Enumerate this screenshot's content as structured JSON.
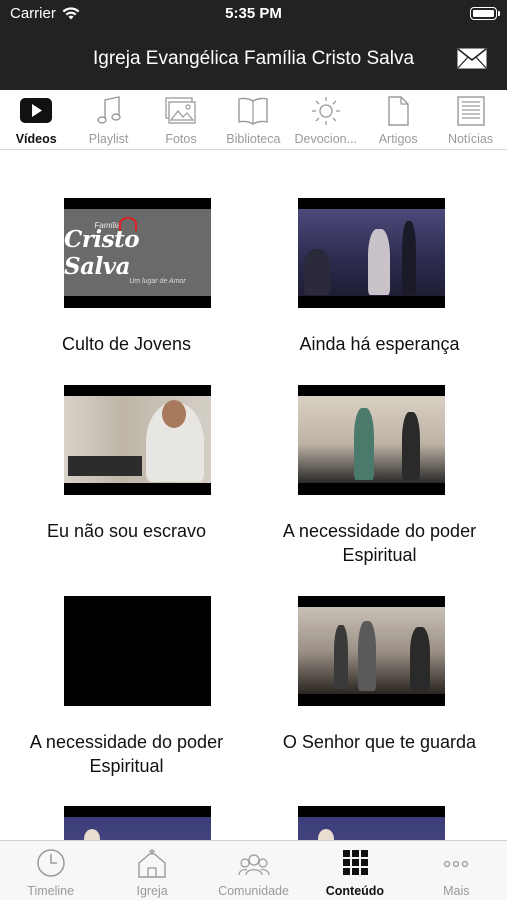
{
  "status_bar": {
    "carrier": "Carrier",
    "time": "5:35 PM"
  },
  "header": {
    "title": "Igreja Evangélica Família Cristo Salva",
    "mail_icon": "envelope-icon"
  },
  "top_tabs": [
    {
      "label": "Vídeos",
      "icon": "play-icon",
      "active": true
    },
    {
      "label": "Playlist",
      "icon": "music-note-icon",
      "active": false
    },
    {
      "label": "Fotos",
      "icon": "photos-icon",
      "active": false
    },
    {
      "label": "Biblioteca",
      "icon": "book-icon",
      "active": false
    },
    {
      "label": "Devocion...",
      "icon": "sun-icon",
      "active": false
    },
    {
      "label": "Artigos",
      "icon": "document-icon",
      "active": false
    },
    {
      "label": "Notícias",
      "icon": "news-icon",
      "active": false
    }
  ],
  "videos": [
    {
      "title": "Culto de Jovens",
      "thumb": "logo",
      "logo": {
        "top": "Família",
        "main": "Cristo Salva",
        "sub": "Um lugar de Amor"
      }
    },
    {
      "title": "Ainda há esperança",
      "thumb": "stage"
    },
    {
      "title": "Eu não sou escravo",
      "thumb": "office"
    },
    {
      "title": "A necessidade do poder Espiritual",
      "thumb": "stage2"
    },
    {
      "title": "A necessidade do poder Espiritual",
      "thumb": "dark"
    },
    {
      "title": "O Senhor que te guarda",
      "thumb": "stage3"
    },
    {
      "title": "",
      "thumb": "blue"
    },
    {
      "title": "",
      "thumb": "blue"
    }
  ],
  "bottom_tabs": [
    {
      "label": "Timeline",
      "icon": "clock-icon",
      "active": false
    },
    {
      "label": "Igreja",
      "icon": "church-icon",
      "active": false
    },
    {
      "label": "Comunidade",
      "icon": "community-icon",
      "active": false
    },
    {
      "label": "Conteúdo",
      "icon": "grid-icon",
      "active": true
    },
    {
      "label": "Mais",
      "icon": "more-dots-icon",
      "active": false
    }
  ],
  "colors": {
    "header_bg": "#222222",
    "active": "#111111",
    "inactive": "#9a9a9a"
  }
}
